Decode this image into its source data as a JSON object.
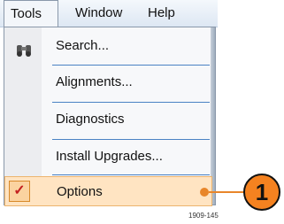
{
  "menubar": {
    "items": [
      {
        "label": "Tools"
      },
      {
        "label": "Window"
      },
      {
        "label": "Help"
      }
    ]
  },
  "menu": {
    "items": [
      {
        "label": "Search..."
      },
      {
        "label": "Alignments..."
      },
      {
        "label": "Diagnostics"
      },
      {
        "label": "Install Upgrades..."
      },
      {
        "label": "Options",
        "checked": true,
        "highlighted": true
      }
    ]
  },
  "callout": {
    "number": "1",
    "color": "#f58220"
  },
  "caption": "1909-145"
}
